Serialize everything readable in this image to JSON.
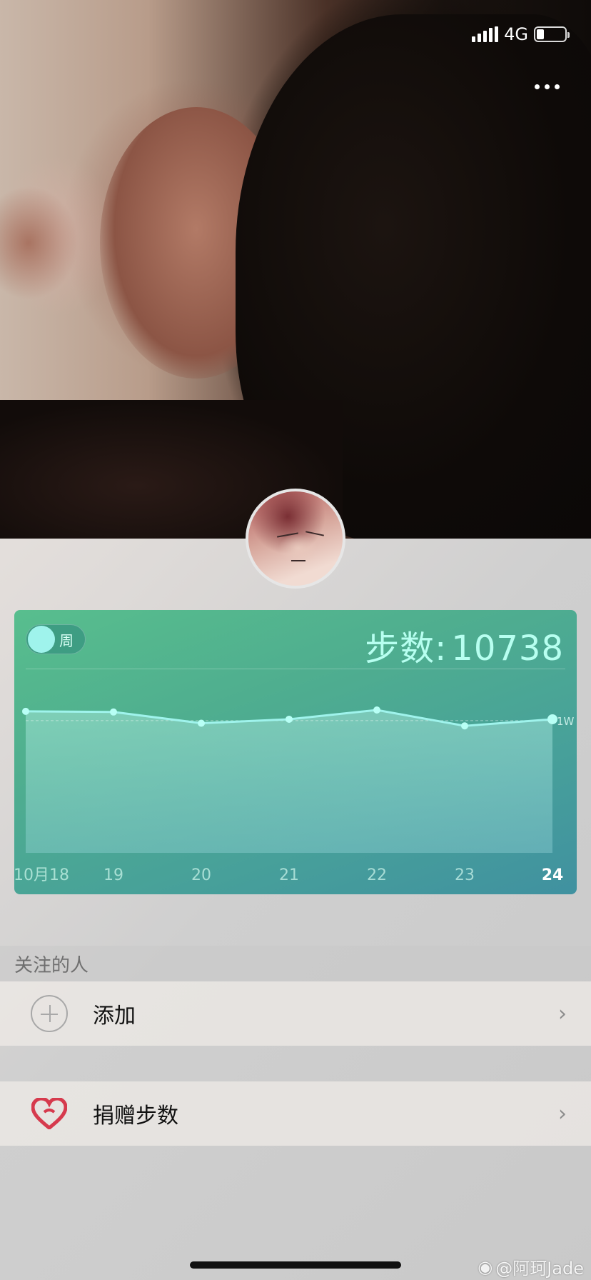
{
  "status_bar": {
    "network": "4G",
    "battery_level": 0.25
  },
  "colors": {
    "card_accent": "#58be8e",
    "line": "#9ff3ec",
    "heart": "#d63a4d"
  },
  "card": {
    "toggle_label": "周",
    "steps_label": "步数:",
    "steps_value": "10738"
  },
  "chart_data": {
    "type": "area",
    "x": [
      "10月18",
      "19",
      "20",
      "21",
      "22",
      "23",
      "24"
    ],
    "values": [
      10700,
      10650,
      9800,
      10100,
      10800,
      9600,
      10100
    ],
    "ylim": [
      0,
      13500
    ],
    "reference_line": {
      "value": 10000,
      "label": "1W"
    },
    "highlight_index": 6
  },
  "following": {
    "section_title": "关注的人",
    "add_label": "添加"
  },
  "donate": {
    "label": "捐赠步数"
  },
  "watermark": "@阿珂Jade"
}
